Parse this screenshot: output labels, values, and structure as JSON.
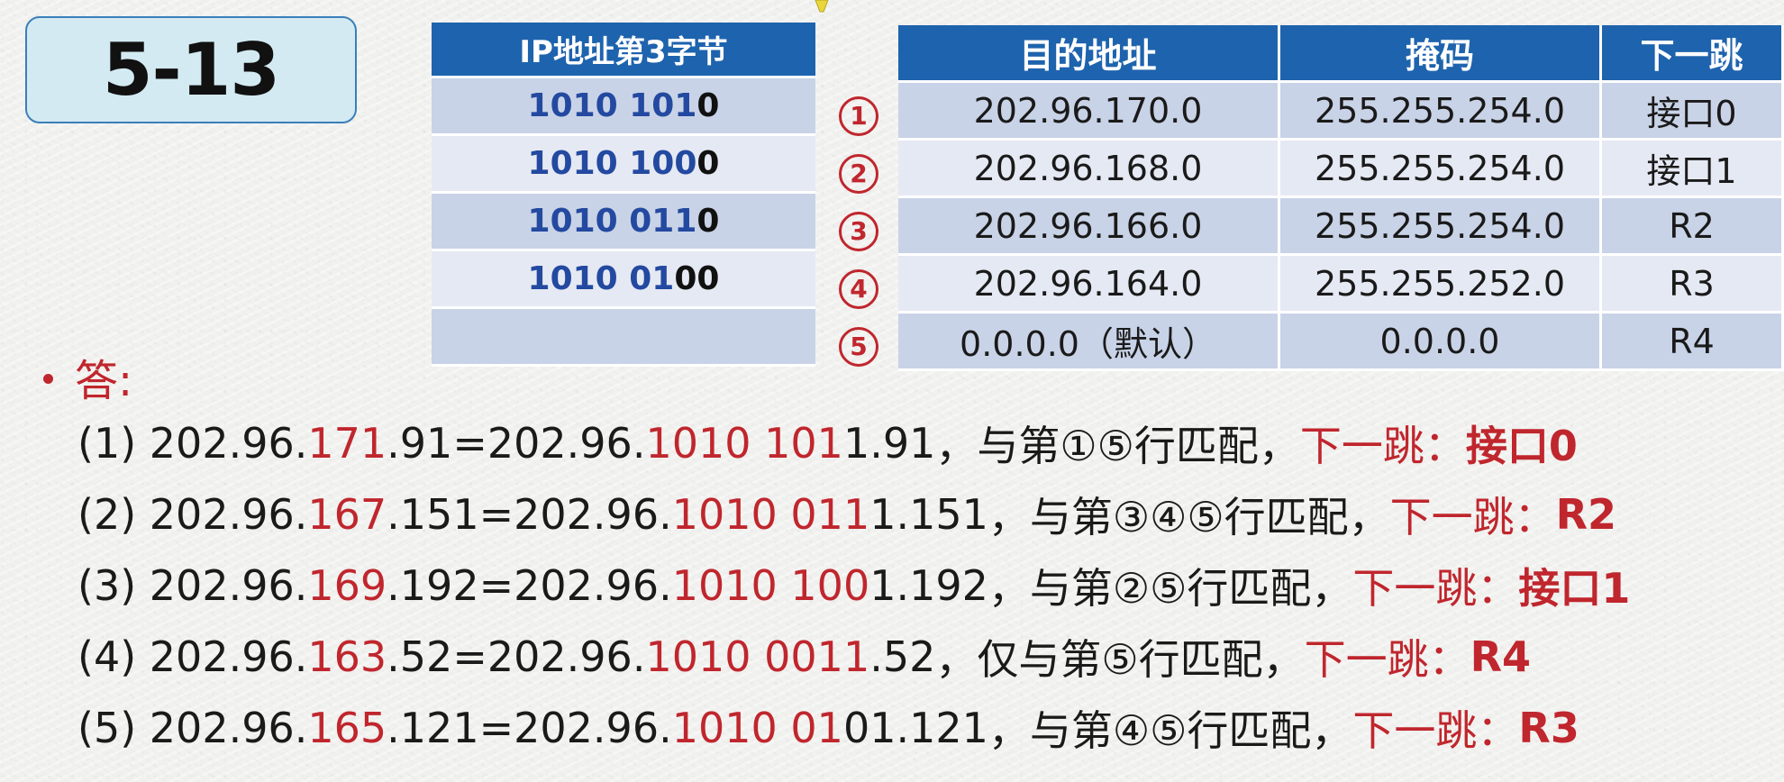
{
  "slide": {
    "title": "5-13"
  },
  "binary_table": {
    "header": "IP地址第3字节",
    "rows": [
      {
        "blue": "1010 101",
        "black": "0"
      },
      {
        "blue": "1010 100",
        "black": "0"
      },
      {
        "blue": "1010 011",
        "black": "0"
      },
      {
        "blue": "1010 01",
        "black": "00"
      },
      {
        "blue": "",
        "black": ""
      }
    ]
  },
  "markers": [
    "1",
    "2",
    "3",
    "4",
    "5"
  ],
  "routing_table": {
    "headers": [
      "目的地址",
      "掩码",
      "下一跳"
    ],
    "rows": [
      [
        "202.96.170.0",
        "255.255.254.0",
        "接口0"
      ],
      [
        "202.96.168.0",
        "255.255.254.0",
        "接口1"
      ],
      [
        "202.96.166.0",
        "255.255.254.0",
        "R2"
      ],
      [
        "202.96.164.0",
        "255.255.252.0",
        "R3"
      ],
      [
        "0.0.0.0（默认）",
        "0.0.0.0",
        "R4"
      ]
    ]
  },
  "answer": {
    "label": "答:",
    "lines": [
      {
        "num": "(1) ",
        "p1": "202.96.",
        "p2": "171",
        "p3": ".91=202.96.",
        "p4": "1010 101",
        "p5": "1.91",
        "p6": "，与第①⑤行匹配，",
        "hop_label": "下一跳：",
        "hop": "接口0"
      },
      {
        "num": "(2) ",
        "p1": "202.96.",
        "p2": "167",
        "p3": ".151=202.96.",
        "p4": "1010 011",
        "p5": "1.151",
        "p6": "，与第③④⑤行匹配，",
        "hop_label": "下一跳：",
        "hop": "R2"
      },
      {
        "num": "(3) ",
        "p1": "202.96.",
        "p2": "169",
        "p3": ".192=202.96.",
        "p4": "1010 100",
        "p5": "1.192",
        "p6": "，与第②⑤行匹配，",
        "hop_label": "下一跳：",
        "hop": "接口1"
      },
      {
        "num": "(4) ",
        "p1": "202.96.",
        "p2": "163",
        "p3": ".52=202.96.",
        "p4": "1010 0011",
        "p5": ".52",
        "p6": "，仅与第⑤行匹配，",
        "hop_label": "下一跳：",
        "hop": "R4"
      },
      {
        "num": "(5) ",
        "p1": "202.96.",
        "p2": "165",
        "p3": ".121=202.96.",
        "p4": "1010 01",
        "p5": "01.121",
        "p6": "，与第④⑤行匹配，",
        "hop_label": "下一跳：",
        "hop": "R3"
      }
    ]
  },
  "colors": {
    "header_blue": "#1e63ad",
    "row_dark": "#c9d3e7",
    "row_light": "#e5e9f3",
    "accent_red": "#c0262d",
    "binary_blue": "#2349a0",
    "title_box_bg": "#d3eaf2"
  },
  "icons": [
    "pointer-tip-icon",
    "bullet-icon",
    "circled-number-icon"
  ]
}
